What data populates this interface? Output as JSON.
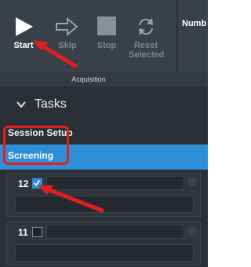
{
  "toolbar": {
    "start_label": "Start",
    "skip_label": "Skip",
    "stop_label": "Stop",
    "reset_label_line1": "Reset",
    "reset_label_line2": "Selected",
    "right_label": "Numb",
    "group_label": "Acquisition"
  },
  "tasks": {
    "title": "Tasks",
    "session_setup": "Session Setup",
    "screening": "Screening",
    "items": [
      {
        "number": "12",
        "checked": true
      },
      {
        "number": "11",
        "checked": false
      }
    ]
  },
  "colors": {
    "accent": "#2e8fd6",
    "annotation": "#e02020",
    "background": "#2b3036"
  }
}
